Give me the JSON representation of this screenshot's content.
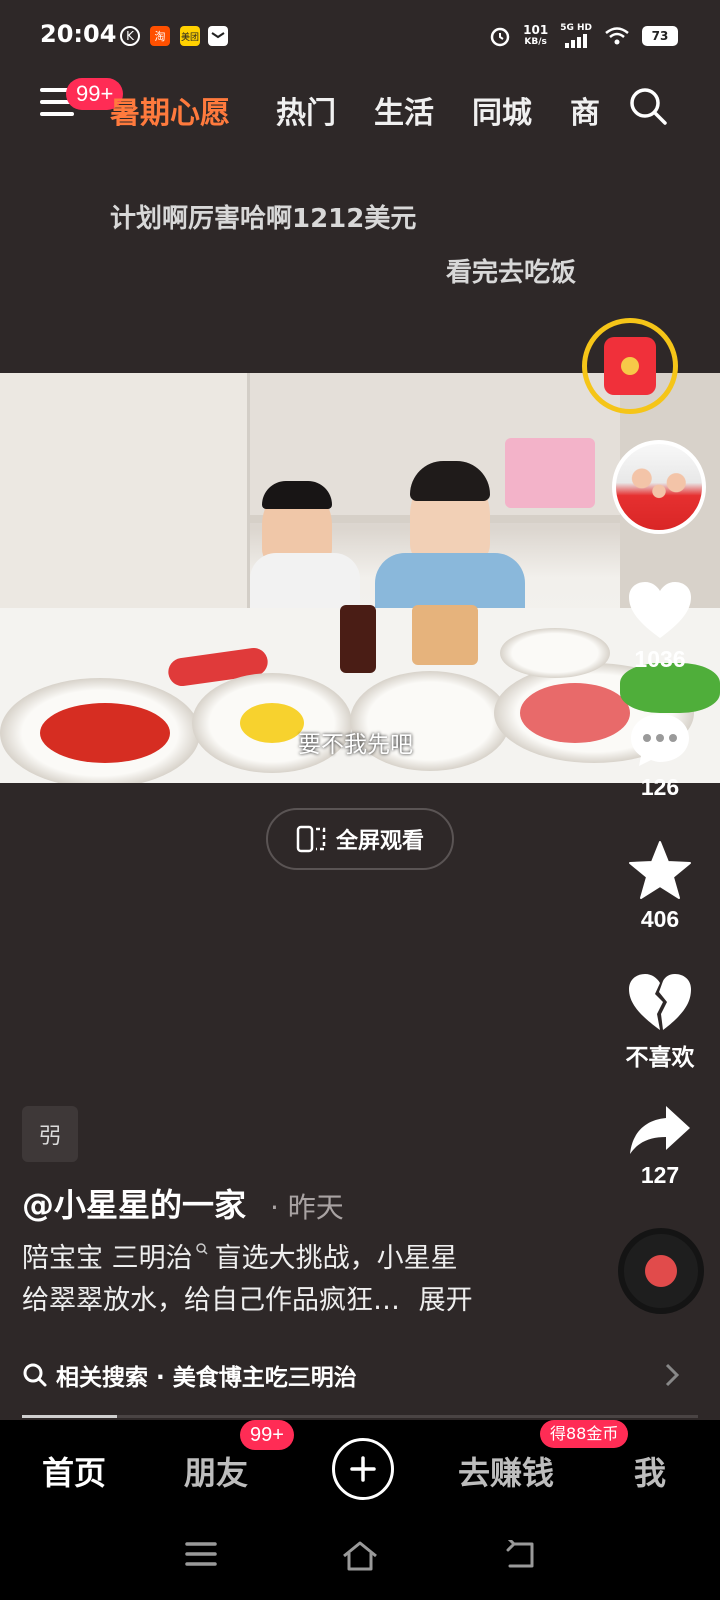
{
  "status_bar": {
    "time": "20:04",
    "net_speed_value": "101",
    "net_speed_unit": "KB/s",
    "network_type": "5G HD",
    "battery": "73",
    "app_icons": [
      "kuaishou-icon",
      "taobao-icon",
      "meituan-icon",
      "message-icon"
    ],
    "taobao_label": "淘",
    "meituan_label": "美团"
  },
  "top_nav": {
    "menu_badge": "99+",
    "tabs": [
      "暑期心愿",
      "热门",
      "生活",
      "同城",
      "商"
    ],
    "promo_color": "#ff7a3d"
  },
  "danmu": [
    "计划啊厉害哈啊1212美元",
    "看完去吃饭"
  ],
  "video": {
    "subtitle": "要不我先吧"
  },
  "fullscreen_label": "全屏观看",
  "actions": {
    "likes": "1036",
    "comments": "126",
    "favorites": "406",
    "dislike_label": "不喜欢",
    "shares": "127"
  },
  "post": {
    "tag": "弜",
    "author": "@小星星的一家",
    "date": "· 昨天",
    "description_line1": "陪宝宝 三明治",
    "description_line1b": "盲选大挑战，小星星",
    "description_line2": "给翠翠放水，给自己作品疯狂…",
    "expand_label": "展开",
    "related_search": "相关搜索 · 美食博主吃三明治",
    "progress": 0.14
  },
  "bottom_tabs": {
    "home": "首页",
    "friends": "朋友",
    "friends_badge": "99+",
    "earn": "去赚钱",
    "earn_badge": "得88金币",
    "me": "我"
  }
}
